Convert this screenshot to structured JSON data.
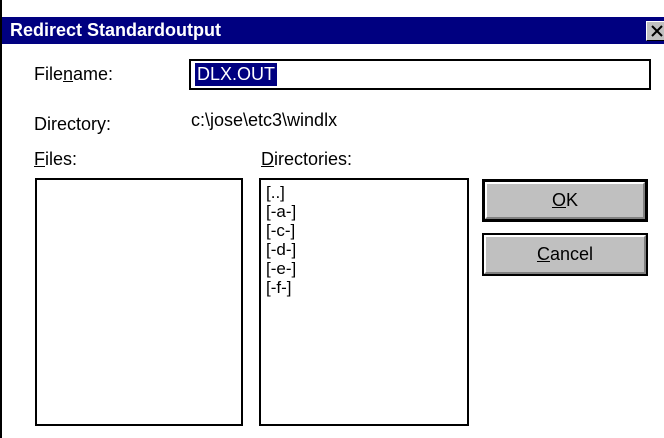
{
  "dialog": {
    "title": "Redirect Standardoutput",
    "filename_label_pre": "File",
    "filename_label_mnemonic": "n",
    "filename_label_post": "ame:",
    "filename_value": "DLX.OUT",
    "directory_label": "Directory:",
    "directory_value": "c:\\jose\\etc3\\windlx",
    "files_label_mnemonic": "F",
    "files_label_post": "iles:",
    "dirs_label_mnemonic": "D",
    "dirs_label_post": "irectories:",
    "files": [],
    "directories": [
      "[..]",
      "[-a-]",
      "[-c-]",
      "[-d-]",
      "[-e-]",
      "[-f-]"
    ],
    "ok_mnemonic": "O",
    "ok_post": "K",
    "cancel_mnemonic": "C",
    "cancel_post": "ancel"
  },
  "colors": {
    "titlebar": "#000080",
    "selection": "#000080",
    "button_face": "#c0c0c0"
  },
  "icons": {
    "close": "close-icon"
  }
}
